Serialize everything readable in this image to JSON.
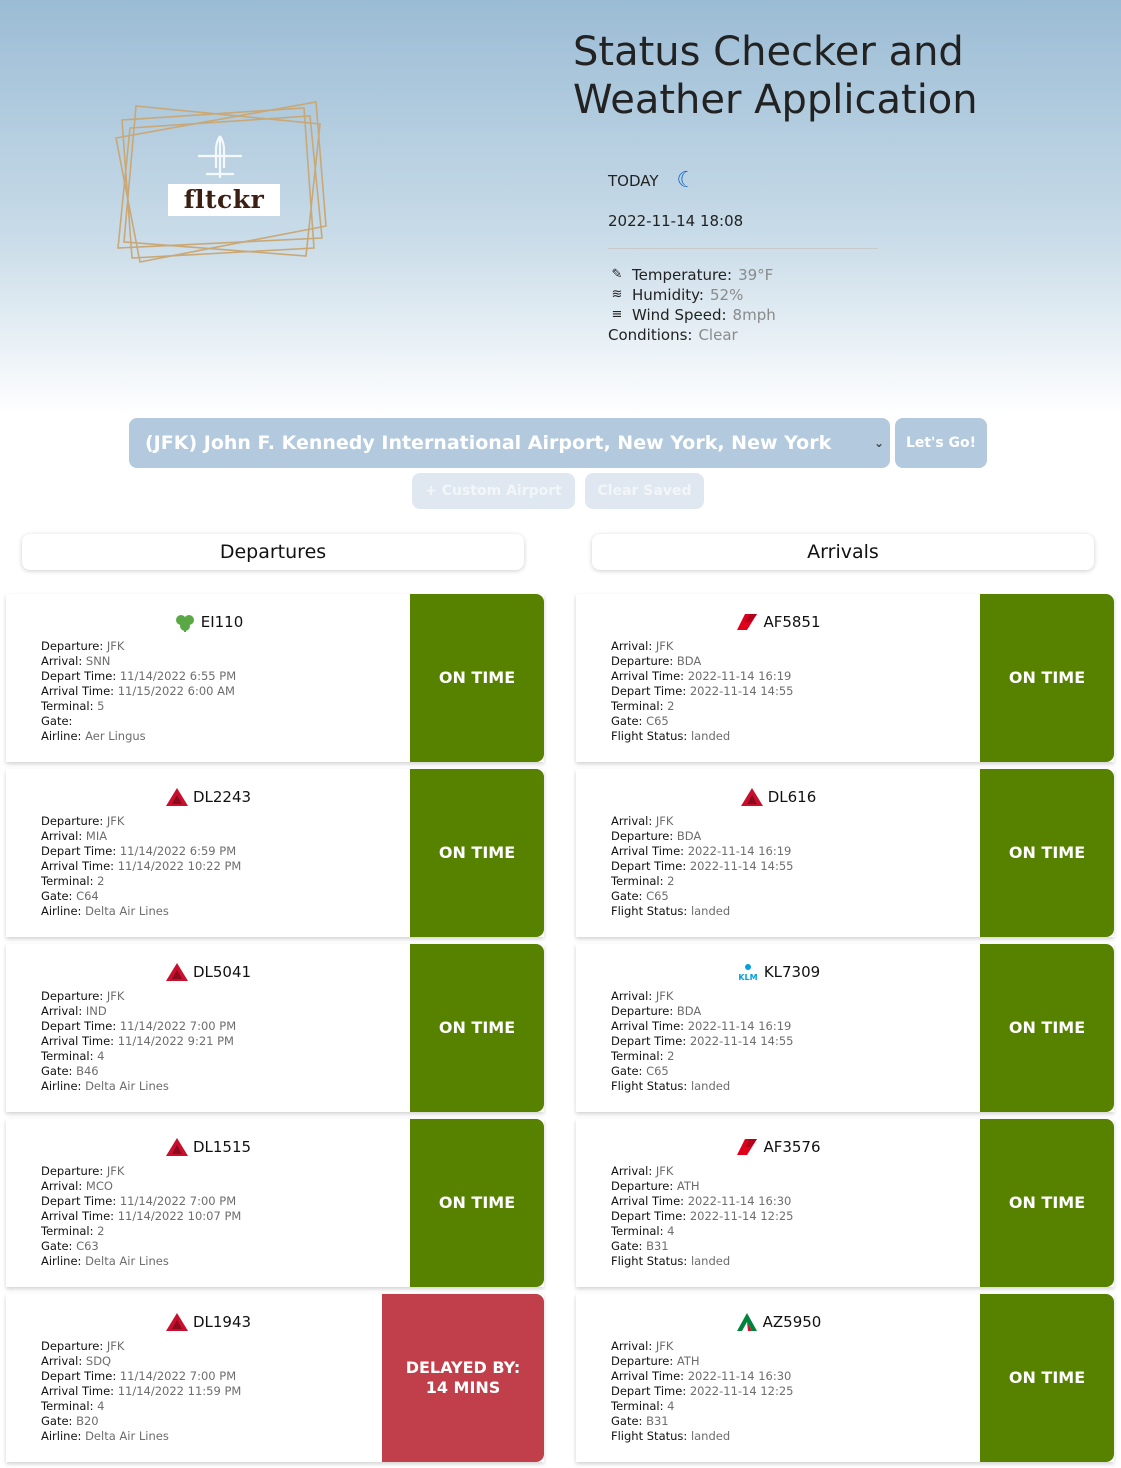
{
  "app": {
    "title_line1": "Status Checker and",
    "title_line2": "Weather Application",
    "logo_text": "fltckr"
  },
  "weather": {
    "today_label": "TODAY",
    "datetime": "2022-11-14 18:08",
    "temperature_label": "Temperature:",
    "temperature_value": "39°F",
    "humidity_label": "Humidity:",
    "humidity_value": "52%",
    "wind_label": "Wind Speed:",
    "wind_value": "8mph",
    "conditions_label": "Conditions:",
    "conditions_value": "Clear"
  },
  "search": {
    "selected_airport": "(JFK) John F. Kennedy International Airport, New York, New York",
    "go_label": "Let's Go!",
    "custom_label": "+ Custom Airport",
    "clear_label": "Clear Saved"
  },
  "columns": {
    "departures_title": "Departures",
    "arrivals_title": "Arrivals"
  },
  "colors": {
    "on_time": "#578200",
    "delayed": "#c03f4a"
  },
  "departures": [
    {
      "flight": "EI110",
      "logo": "shamrock-icon",
      "departure": "JFK",
      "arrival": "SNN",
      "depart_time": "11/14/2022 6:55 PM",
      "arrival_time": "11/15/2022 6:00 AM",
      "terminal": "5",
      "gate": "",
      "airline": "Aer Lingus",
      "status": "ON TIME"
    },
    {
      "flight": "DL2243",
      "logo": "delta-icon",
      "departure": "JFK",
      "arrival": "MIA",
      "depart_time": "11/14/2022 6:59 PM",
      "arrival_time": "11/14/2022 10:22 PM",
      "terminal": "2",
      "gate": "C64",
      "airline": "Delta Air Lines",
      "status": "ON TIME"
    },
    {
      "flight": "DL5041",
      "logo": "delta-icon",
      "departure": "JFK",
      "arrival": "IND",
      "depart_time": "11/14/2022 7:00 PM",
      "arrival_time": "11/14/2022 9:21 PM",
      "terminal": "4",
      "gate": "B46",
      "airline": "Delta Air Lines",
      "status": "ON TIME"
    },
    {
      "flight": "DL1515",
      "logo": "delta-icon",
      "departure": "JFK",
      "arrival": "MCO",
      "depart_time": "11/14/2022 7:00 PM",
      "arrival_time": "11/14/2022 10:07 PM",
      "terminal": "2",
      "gate": "C63",
      "airline": "Delta Air Lines",
      "status": "ON TIME"
    },
    {
      "flight": "DL1943",
      "logo": "delta-icon",
      "departure": "JFK",
      "arrival": "SDQ",
      "depart_time": "11/14/2022 7:00 PM",
      "arrival_time": "11/14/2022 11:59 PM",
      "terminal": "4",
      "gate": "B20",
      "airline": "Delta Air Lines",
      "status": "DELAYED BY: 14 MINS"
    }
  ],
  "arrivals": [
    {
      "flight": "AF5851",
      "logo": "air-france-icon",
      "arrival": "JFK",
      "departure": "BDA",
      "arrival_time": "2022-11-14 16:19",
      "depart_time": "2022-11-14 14:55",
      "terminal": "2",
      "gate": "C65",
      "flight_status": "landed",
      "status": "ON TIME"
    },
    {
      "flight": "DL616",
      "logo": "delta-icon",
      "arrival": "JFK",
      "departure": "BDA",
      "arrival_time": "2022-11-14 16:19",
      "depart_time": "2022-11-14 14:55",
      "terminal": "2",
      "gate": "C65",
      "flight_status": "landed",
      "status": "ON TIME"
    },
    {
      "flight": "KL7309",
      "logo": "klm-icon",
      "arrival": "JFK",
      "departure": "BDA",
      "arrival_time": "2022-11-14 16:19",
      "depart_time": "2022-11-14 14:55",
      "terminal": "2",
      "gate": "C65",
      "flight_status": "landed",
      "status": "ON TIME"
    },
    {
      "flight": "AF3576",
      "logo": "air-france-icon",
      "arrival": "JFK",
      "departure": "ATH",
      "arrival_time": "2022-11-14 16:30",
      "depart_time": "2022-11-14 12:25",
      "terminal": "4",
      "gate": "B31",
      "flight_status": "landed",
      "status": "ON TIME"
    },
    {
      "flight": "AZ5950",
      "logo": "alitalia-icon",
      "arrival": "JFK",
      "departure": "ATH",
      "arrival_time": "2022-11-14 16:30",
      "depart_time": "2022-11-14 12:25",
      "terminal": "4",
      "gate": "B31",
      "flight_status": "landed",
      "status": "ON TIME"
    }
  ]
}
